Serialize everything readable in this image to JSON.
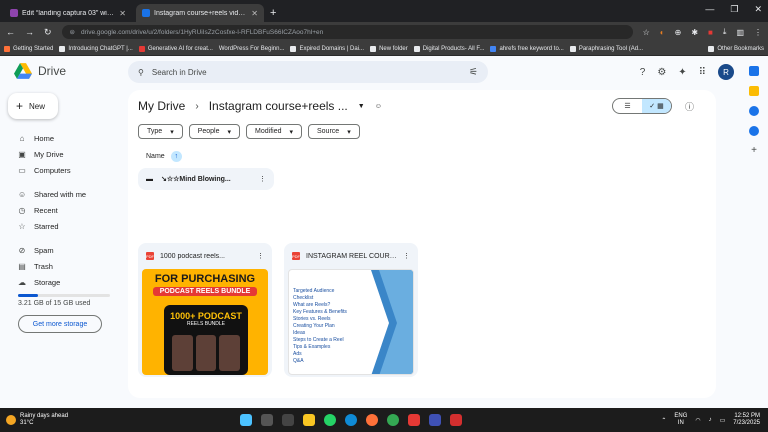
{
  "browser": {
    "tabs": [
      {
        "title": "Edit “landing captura 03” with El",
        "active": false,
        "fav_color": "#8e44ad"
      },
      {
        "title": "Instagram course+reels videos",
        "active": true,
        "fav_color": "#1a73e8"
      }
    ],
    "url": "drive.google.com/drive/u/2/folders/1HyRUiIsZzCosfxe-l-RFLDBFuS66ICZAoo7hl+en",
    "bookmarks": [
      {
        "label": "Getting Started",
        "color": "#ff7139"
      },
      {
        "label": "Introducing ChatGPT |...",
        "color": "#e8eaed"
      },
      {
        "label": "Generative AI for creat...",
        "color": "#e53935"
      },
      {
        "label": "WordPress For Beginn...",
        "color": "#9aa0a6"
      },
      {
        "label": "Expired Domains | Dai...",
        "color": "#e8eaed"
      },
      {
        "label": "New folder",
        "color": "#e8eaed"
      },
      {
        "label": "Digital Products- All F...",
        "color": "#e8eaed"
      },
      {
        "label": "ahrefs free keyword to...",
        "color": "#4285f4"
      },
      {
        "label": "Paraphrasing Tool (Ad...",
        "color": "#e8eaed"
      }
    ],
    "other_bookmarks": "Other Bookmarks"
  },
  "drive": {
    "brand": "Drive",
    "search_placeholder": "Search in Drive",
    "avatar_letter": "R",
    "new_label": "New",
    "nav": [
      {
        "label": "Home",
        "icon": "home-icon",
        "glyph": "⌂"
      },
      {
        "label": "My Drive",
        "icon": "my-drive-icon",
        "glyph": "▣"
      },
      {
        "label": "Computers",
        "icon": "computer-icon",
        "glyph": "▭"
      },
      {
        "label": "Shared with me",
        "icon": "shared-icon",
        "glyph": "☺"
      },
      {
        "label": "Recent",
        "icon": "clock-icon",
        "glyph": "◷"
      },
      {
        "label": "Starred",
        "icon": "star-icon",
        "glyph": "☆"
      },
      {
        "label": "Spam",
        "icon": "spam-icon",
        "glyph": "⊘"
      },
      {
        "label": "Trash",
        "icon": "trash-icon",
        "glyph": "🗑"
      },
      {
        "label": "Storage",
        "icon": "cloud-icon",
        "glyph": "☁"
      }
    ],
    "storage_text": "3.21 GB of 15 GB used",
    "storage_fraction": 0.214,
    "more_storage": "Get more storage",
    "breadcrumb_root": "My Drive",
    "breadcrumb_current": "Instagram course+reels ...",
    "filters": [
      "Type",
      "People",
      "Modified",
      "Source"
    ],
    "sort_label": "Name",
    "folder_name": "↘☆☆Mind Blowing...",
    "files": [
      {
        "title": "1000 podcast reels..."
      },
      {
        "title": "INSTAGRAM REEL COURS..."
      }
    ],
    "thumb1": {
      "line1": "FOR PURCHASING",
      "line2": "PODCAST REELS BUNDLE",
      "big": "1000+ PODCAST",
      "sub": "REELS BUNDLE"
    },
    "thumb2_lines": [
      "Targeted Audience",
      "Checklist",
      "What are Reels?",
      "Key Features & Benefits",
      "Stories vs. Reels",
      "Creating Your Plan",
      "Ideas",
      "Steps to Create a Reel",
      "Tips & Examples",
      "Ads",
      "Q&A"
    ]
  },
  "taskbar": {
    "weather_line1": "Rainy days ahead",
    "weather_line2": "31°C",
    "lang_line1": "ENG",
    "lang_line2": "IN",
    "time": "12:52 PM",
    "date": "7/23/2025"
  }
}
